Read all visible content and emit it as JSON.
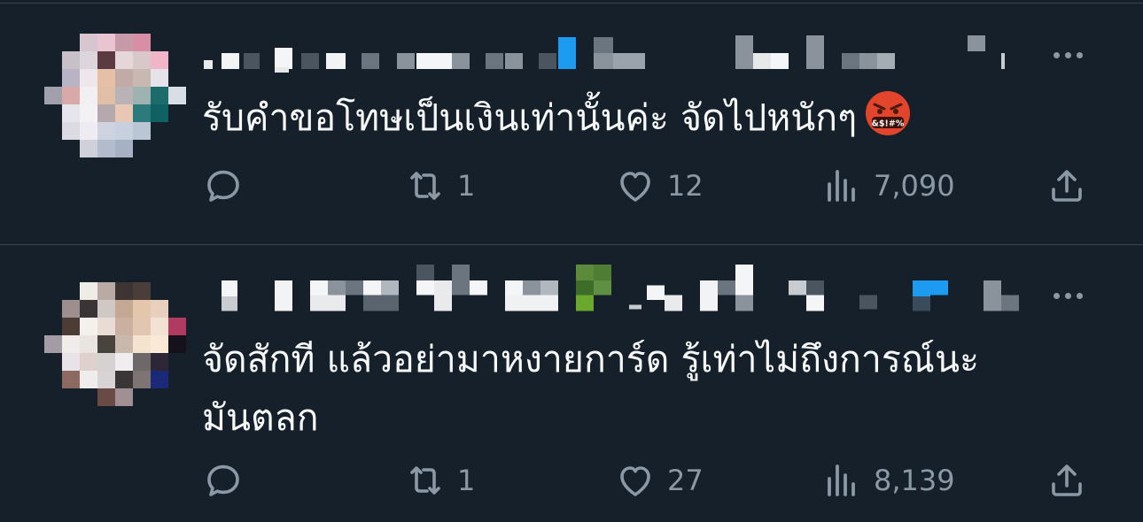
{
  "tweets": [
    {
      "text": "รับคำขอโทษเป็นเงินเท่านั้นค่ะ จัดไปหนักๆ",
      "emoji": "face-with-symbols-on-mouth",
      "emoji_text": "&$!#%",
      "retweets": "1",
      "likes": "12",
      "views": "7,090"
    },
    {
      "text": "จัดสักที แล้วอย่ามาหงายการ์ด รู้เท่าไม่ถึงการณ์นะ\nมันตลก",
      "retweets": "1",
      "likes": "27",
      "views": "8,139"
    }
  ],
  "icons": {
    "reply": "reply-icon",
    "retweet": "retweet-icon",
    "like": "heart-icon",
    "views": "views-chart-icon",
    "share": "share-icon",
    "more": "more-icon"
  },
  "colors": {
    "background": "#15202b",
    "text": "#f7f9f9",
    "muted": "#8b98a5",
    "divider": "#38444d",
    "emoji_face": "#e2452b"
  }
}
